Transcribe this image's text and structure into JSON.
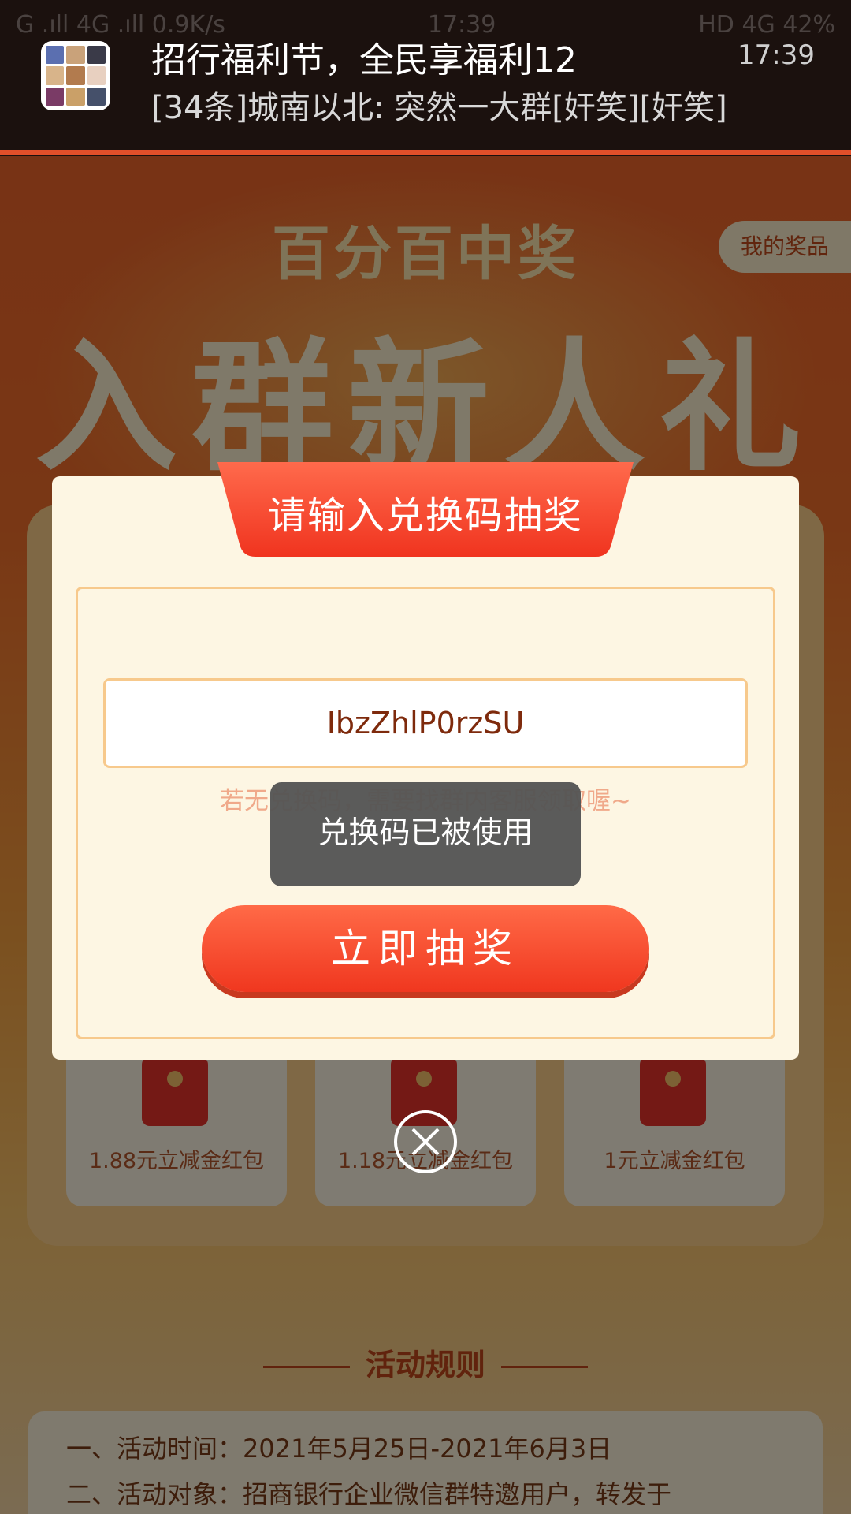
{
  "status_bar": {
    "left": "G .ıll 4G .ıll 0.9K/s",
    "time": "17:39",
    "right": "HD 4G 42%"
  },
  "notification": {
    "title": "招行福利节，全民享福利12",
    "time": "17:39",
    "message": "[34条]城南以北: 突然一大群[奸笑][奸笑]"
  },
  "background": {
    "subtitle": "百分百中奖",
    "headline": "入群新人礼",
    "my_prizes": "我的奖品",
    "prizes": [
      {
        "label": "1.88元立减金红包"
      },
      {
        "label": "1.18元立减金红包"
      },
      {
        "label": "1元立减金红包"
      }
    ],
    "rules_title": "活动规则",
    "rules": [
      "一、活动时间：2021年5月25日-2021年6月3日",
      "二、活动对象：招商银行企业微信群特邀用户，转发于"
    ]
  },
  "dialog": {
    "title": "请输入兑换码抽奖",
    "code_value": "IbzZhlP0rzSU",
    "hint": "若无兑换码，需要找群内客服领取喔~",
    "button": "立即抽奖",
    "toast": "兑换码已被使用"
  },
  "colors": {
    "accent": "#f0371f",
    "ribbon": "#f4482c",
    "panel": "#fdf6e3",
    "border": "#f7c98c"
  }
}
